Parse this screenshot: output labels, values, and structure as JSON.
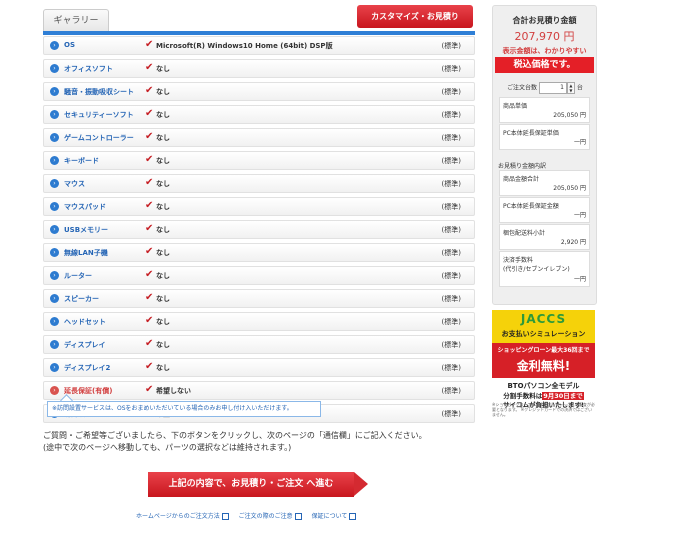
{
  "tabs": {
    "gallery": "ギャラリー",
    "customize": "カスタマイズ・お見積り"
  },
  "parts": [
    {
      "name": "OS",
      "value": "Microsoft(R) Windows10 Home (64bit) DSP版",
      "std": "(標準)",
      "icon": "arrow-circle-icon",
      "red": false
    },
    {
      "name": "オフィスソフト",
      "value": "なし",
      "std": "(標準)",
      "icon": "arrow-circle-icon",
      "red": false
    },
    {
      "name": "騒音・振動吸収シート",
      "value": "なし",
      "std": "(標準)",
      "icon": "arrow-circle-icon",
      "red": false
    },
    {
      "name": "セキュリティーソフト",
      "value": "なし",
      "std": "(標準)",
      "icon": "arrow-circle-icon",
      "red": false
    },
    {
      "name": "ゲームコントローラー",
      "value": "なし",
      "std": "(標準)",
      "icon": "arrow-circle-icon",
      "red": false
    },
    {
      "name": "キーボード",
      "value": "なし",
      "std": "(標準)",
      "icon": "arrow-circle-icon",
      "red": false
    },
    {
      "name": "マウス",
      "value": "なし",
      "std": "(標準)",
      "icon": "arrow-circle-icon",
      "red": false
    },
    {
      "name": "マウスパッド",
      "value": "なし",
      "std": "(標準)",
      "icon": "arrow-circle-icon",
      "red": false
    },
    {
      "name": "USBメモリー",
      "value": "なし",
      "std": "(標準)",
      "icon": "arrow-circle-icon",
      "red": false
    },
    {
      "name": "無線LAN子機",
      "value": "なし",
      "std": "(標準)",
      "icon": "arrow-circle-icon",
      "red": false
    },
    {
      "name": "ルーター",
      "value": "なし",
      "std": "(標準)",
      "icon": "arrow-circle-icon",
      "red": false
    },
    {
      "name": "スピーカー",
      "value": "なし",
      "std": "(標準)",
      "icon": "arrow-circle-icon",
      "red": false
    },
    {
      "name": "ヘッドセット",
      "value": "なし",
      "std": "(標準)",
      "icon": "arrow-circle-icon",
      "red": false
    },
    {
      "name": "ディスプレイ",
      "value": "なし",
      "std": "(標準)",
      "icon": "arrow-circle-icon",
      "red": false
    },
    {
      "name": "ディスプレイ2",
      "value": "なし",
      "std": "(標準)",
      "icon": "arrow-circle-icon",
      "red": false
    },
    {
      "name": "延長保証(有償)",
      "value": "希望しない",
      "std": "(標準)",
      "icon": "arrow-circle-icon",
      "red": true
    },
    {
      "name": "訪問設置サービス",
      "value": "希望しない",
      "std": "(標準)",
      "icon": "arrow-circle-icon",
      "red": false
    }
  ],
  "note": "※訪問設置サービスは、OSをおまめいただいている場合のみお申し付け入いただけます。",
  "info": {
    "line1": "ご質問・ご希望等ございましたら、下のボタンをクリックし、次のページの「通信欄」にご記入ください。",
    "line2": "(途中で次のページへ移動しても、パーツの選択などは維持されます。)"
  },
  "submit_label": "上記の内容で、お見積り・ご注文 へ進む",
  "footer_links": [
    "ホームページからのご注文方法",
    "ご注文の際のご注意",
    "保証について"
  ],
  "sidebar": {
    "title": "合計お見積り金額",
    "total": "207,970 円",
    "note1": "表示金額は、わかりやすい",
    "note2": "税込価格です。",
    "qty_label": "ご注文台数",
    "qty_value": "1",
    "qty_unit": "台",
    "unit_price_label": "商品単価",
    "unit_price_value": "205,050 円",
    "warranty_unit_label": "PC本体延長保証単価",
    "warranty_unit_value": "一円",
    "breakdown_title": "お見積り金額内訳",
    "subtotal_label": "商品金額合計",
    "subtotal_value": "205,050 円",
    "warranty_total_label": "PC本体延長保証金額",
    "warranty_total_value": "一円",
    "shipping_label": "梱包配送料小計",
    "shipping_value": "2,920 円",
    "fee_label": "決済手数料",
    "fee_sub": "(代引き/セブンイレブン)",
    "fee_value": "一円"
  },
  "banner": {
    "logo": "JACCS",
    "sub": "お支払いシミュレーション",
    "red1": "ショッピングローン最大36回まで",
    "red2": "金利無料!",
    "b1": "BTOパソコン全モデル",
    "b2a": "分割手数料は",
    "b2b": "9月30日まで",
    "b3": "サイコムが負担いたします!",
    "fine": "※ショッピングローンは、株式会社ジャックスの審査が必要となります。 ※クレジットカードでの決済ではございません。"
  }
}
